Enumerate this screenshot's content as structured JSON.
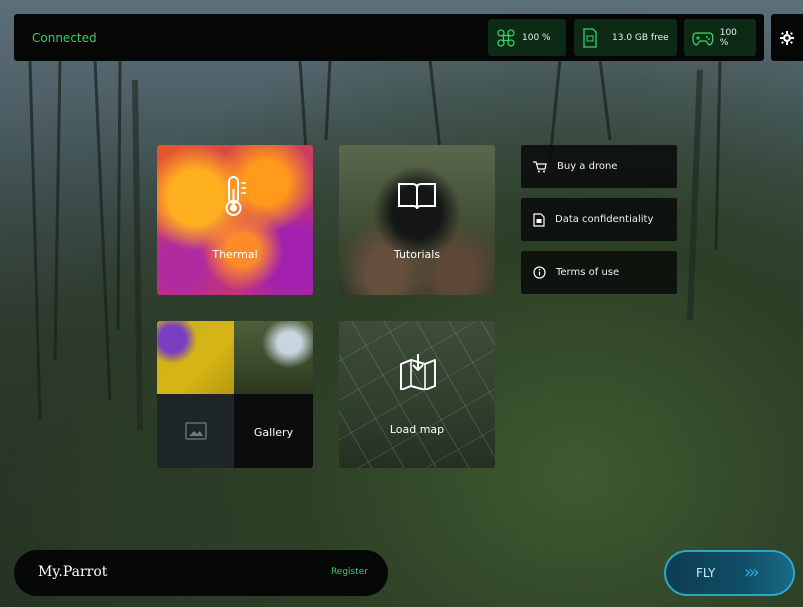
{
  "status": {
    "connection": "Connected",
    "drone_battery": "100 %",
    "storage": "13.0 GB free",
    "controller_battery": "100 %"
  },
  "tiles": {
    "thermal": "Thermal",
    "tutorials": "Tutorials",
    "gallery": "Gallery",
    "load_map": "Load map"
  },
  "links": [
    {
      "label": "Buy a drone",
      "icon": "cart-icon"
    },
    {
      "label": "Data confidentiality",
      "icon": "document-icon"
    },
    {
      "label": "Terms of use",
      "icon": "info-icon"
    }
  ],
  "account": {
    "name": "My.Parrot",
    "register_label": "Register"
  },
  "fly": {
    "label": "FLY",
    "chevrons": "›››"
  },
  "colors": {
    "status_green": "#37d06a",
    "status_box": "#0c2a16",
    "fly_accent": "#2aa6c8"
  }
}
